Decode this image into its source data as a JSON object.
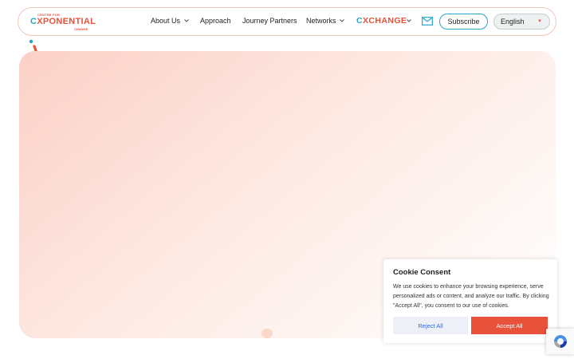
{
  "logo": {
    "top": "CENTRE FOR",
    "main_first": "C",
    "main_rest": "XPONENTIAL",
    "bottom": "CHANGE"
  },
  "nav": {
    "about_us": "About Us",
    "approach": "Approach",
    "journey_partners": "Journey Partners",
    "networks": "Networks",
    "exchange_first": "C",
    "exchange_rest": "XCHANGE",
    "subscribe": "Subscribe",
    "language": "English"
  },
  "cookie": {
    "title": "Cookie Consent",
    "text": "We use cookies to enhance your browsing experience, serve personalized ads or content, and analyze our traffic. By clicking \"Accept All\", you consent to our use of cookies.",
    "reject": "Reject All",
    "accept": "Accept All"
  },
  "icons": {
    "chevron": "chevron-down-icon",
    "mail": "mail-icon",
    "language_caret": "caret-down-icon",
    "recaptcha": "recaptcha-icon"
  },
  "colors": {
    "brand_orange": "#e8513a",
    "brand_blue": "#29a3c9",
    "hero_peach": "#fbd0c6"
  }
}
